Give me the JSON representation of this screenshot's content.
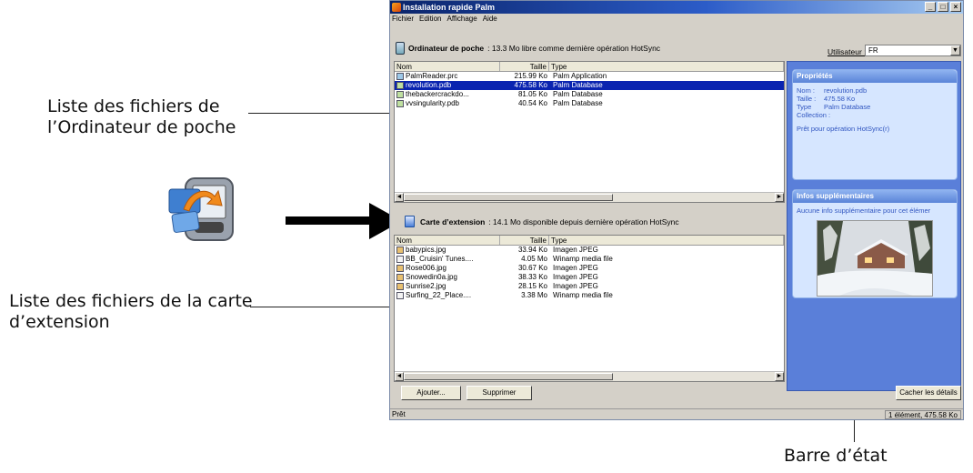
{
  "callouts": {
    "device_files": "Liste des fichiers de l’Ordinateur de poche",
    "card_files": "Liste des fichiers de la carte d’extension",
    "status_bar": "Barre d’état"
  },
  "window": {
    "title": "Installation rapide Palm",
    "menu": [
      "Fichier",
      "Edition",
      "Affichage",
      "Aide"
    ]
  },
  "device": {
    "label": "Ordinateur de poche",
    "info": ": 13.3 Mo libre comme dernière opération HotSync",
    "user_label": "Utilisateur :",
    "user_value": "FR",
    "columns": [
      "Nom",
      "Taille",
      "Type"
    ],
    "files": [
      {
        "name": "PalmReader.prc",
        "size": "215.99 Ko",
        "type": "Palm Application",
        "icon": "prc"
      },
      {
        "name": "revolution.pdb",
        "size": "475.58 Ko",
        "type": "Palm Database",
        "icon": "pdb",
        "selected": true
      },
      {
        "name": "thebackercrackdo...",
        "size": "81.05 Ko",
        "type": "Palm Database",
        "icon": "pdb"
      },
      {
        "name": "vvsingularity.pdb",
        "size": "40.54 Ko",
        "type": "Palm Database",
        "icon": "pdb"
      }
    ]
  },
  "card": {
    "label": "Carte d’extension",
    "info": ": 14.1 Mo disponible depuis dernière opération HotSync",
    "columns": [
      "Nom",
      "Taille",
      "Type"
    ],
    "files": [
      {
        "name": "babypics.jpg",
        "size": "33.94 Ko",
        "type": "Imagen JPEG",
        "icon": "jpg"
      },
      {
        "name": "BB_Cruisin' Tunes....",
        "size": "4.05 Mo",
        "type": "Winamp media file",
        "icon": "mp3"
      },
      {
        "name": "Rose006.jpg",
        "size": "30.67 Ko",
        "type": "Imagen JPEG",
        "icon": "jpg"
      },
      {
        "name": "Snowedin0a.jpg",
        "size": "38.33 Ko",
        "type": "Imagen JPEG",
        "icon": "jpg"
      },
      {
        "name": "Sunrise2.jpg",
        "size": "28.15 Ko",
        "type": "Imagen JPEG",
        "icon": "jpg"
      },
      {
        "name": "Surfing_22_Place....",
        "size": "3.38 Mo",
        "type": "Winamp media file",
        "icon": "mp3"
      }
    ]
  },
  "properties": {
    "title": "Propriétés",
    "name_label": "Nom :",
    "name_value": "revolution.pdb",
    "size_label": "Taille :",
    "size_value": "475.58 Ko",
    "type_label": "Type",
    "type_value": "Palm Database",
    "collection_label": "Collection :",
    "ready": "Prêt pour opération HotSync(r)"
  },
  "extra": {
    "title": "Infos supplémentaires",
    "text": "Aucune info supplémentaire pour cet élémer"
  },
  "buttons": {
    "add": "Ajouter...",
    "delete": "Supprimer",
    "hide_details": "Cacher les détails"
  },
  "status": {
    "left": "Prêt",
    "right": "1 élément, 475.58 Ko"
  }
}
